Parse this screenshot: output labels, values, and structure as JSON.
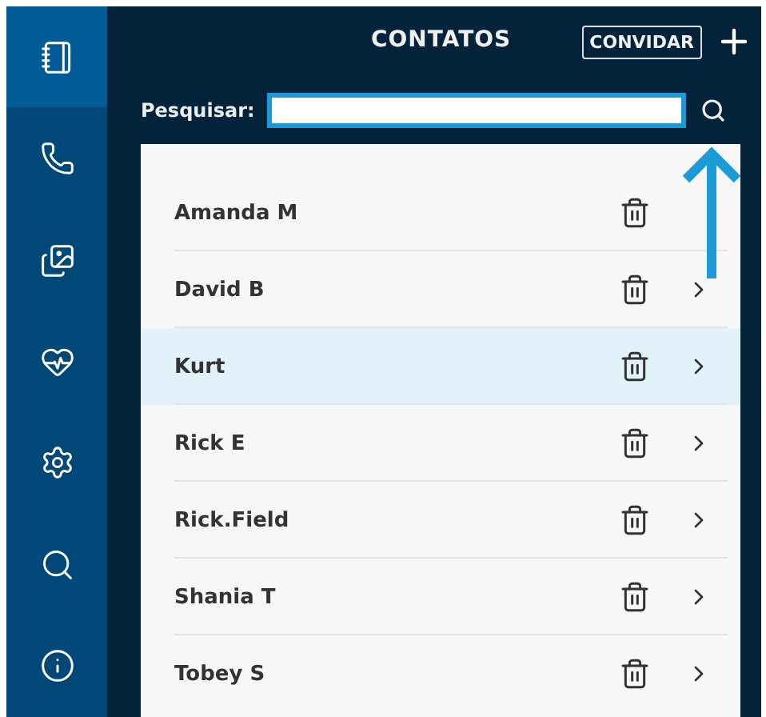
{
  "sidebar": {
    "items": [
      {
        "kind": "contacts",
        "selected": true
      },
      {
        "kind": "phone",
        "selected": false
      },
      {
        "kind": "gallery",
        "selected": false
      },
      {
        "kind": "health",
        "selected": false
      },
      {
        "kind": "settings",
        "selected": false
      },
      {
        "kind": "search",
        "selected": false
      },
      {
        "kind": "info",
        "selected": false
      }
    ]
  },
  "header": {
    "title": "CONTATOS",
    "invite_button": "CONVIDAR"
  },
  "search": {
    "label": "Pesquisar:"
  },
  "contacts": [
    {
      "name": "Amanda M",
      "selected": false,
      "chevron": false
    },
    {
      "name": "David B",
      "selected": false,
      "chevron": true
    },
    {
      "name": "Kurt",
      "selected": true,
      "chevron": true
    },
    {
      "name": "Rick E",
      "selected": false,
      "chevron": true
    },
    {
      "name": "Rick.Field",
      "selected": false,
      "chevron": true
    },
    {
      "name": "Shania T",
      "selected": false,
      "chevron": true
    },
    {
      "name": "Tobey S",
      "selected": false,
      "chevron": true
    }
  ]
}
